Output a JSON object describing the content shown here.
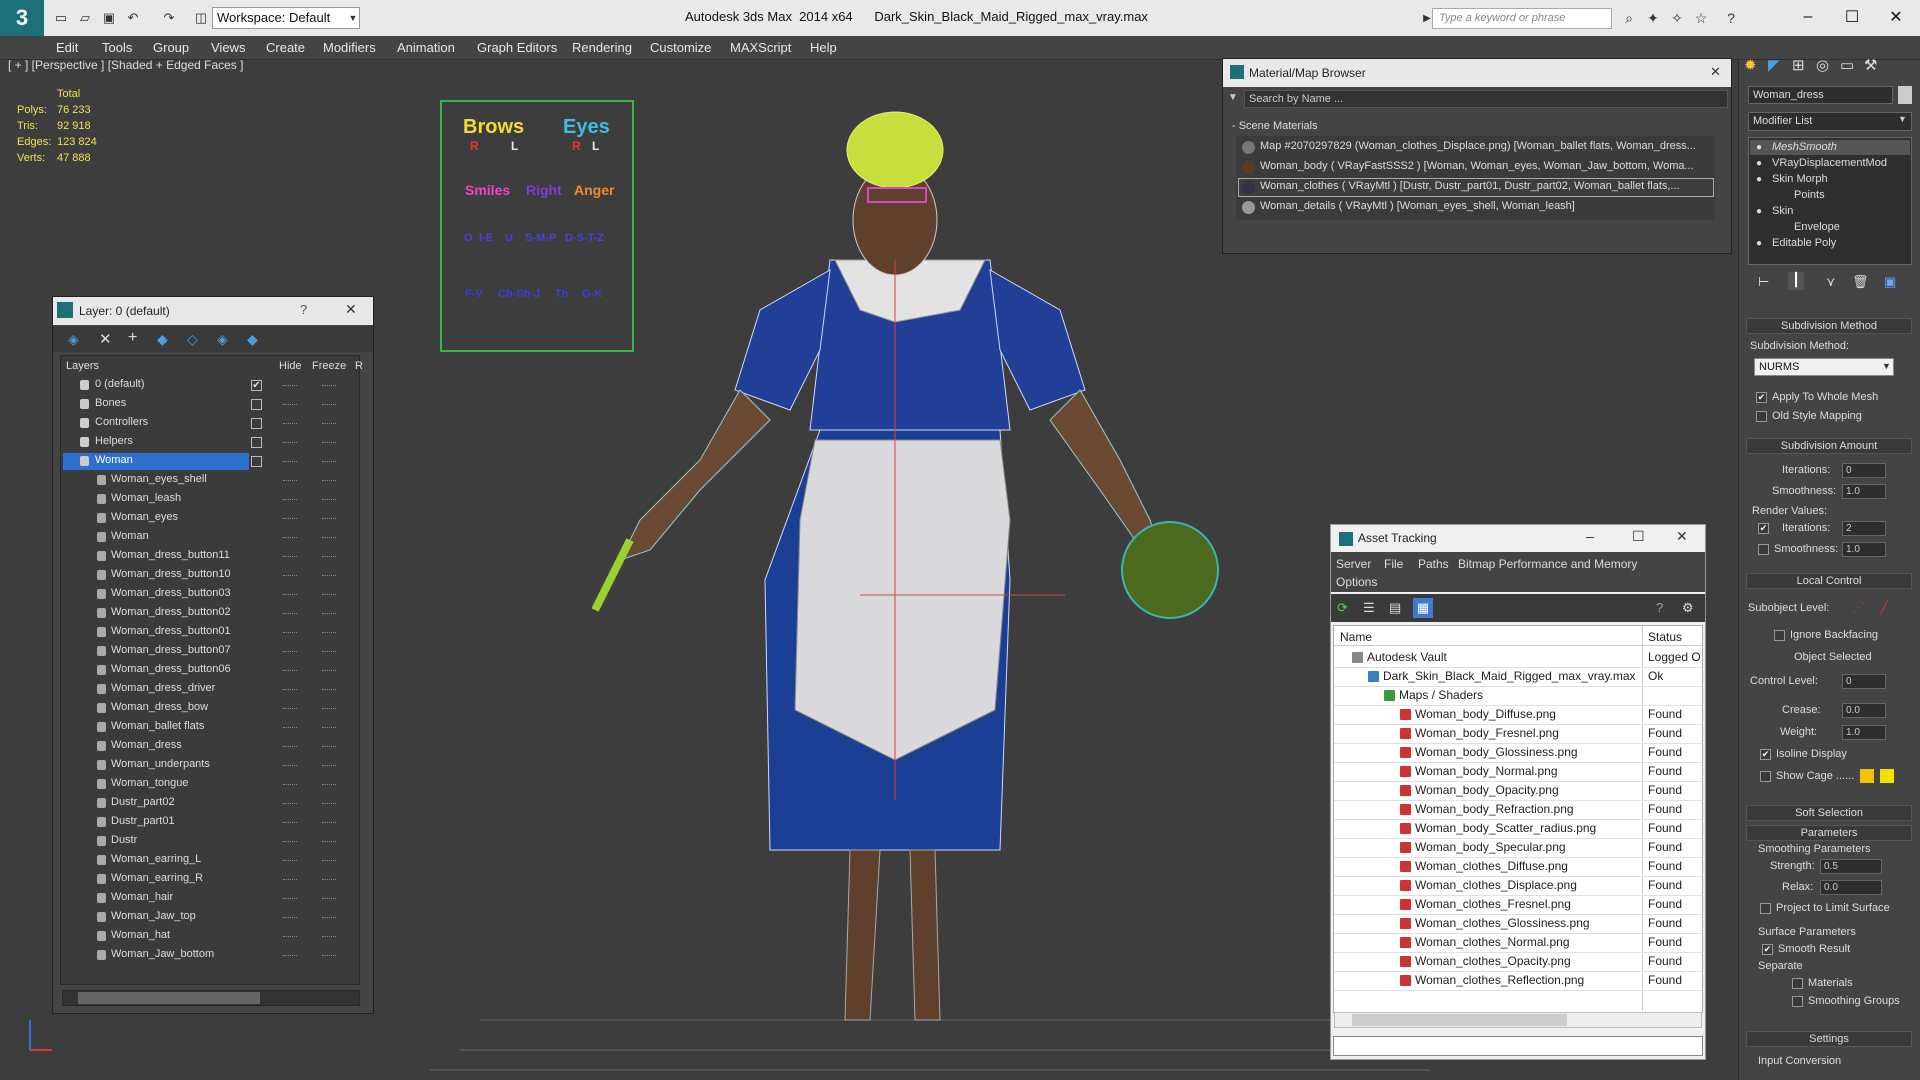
{
  "app": {
    "title": "Autodesk 3ds Max  2014 x64      Dark_Skin_Black_Maid_Rigged_max_vray.max",
    "workspace": "Workspace: Default",
    "search_placeholder": "Type a keyword or phrase"
  },
  "menus": [
    "Edit",
    "Tools",
    "Group",
    "Views",
    "Create",
    "Modifiers",
    "Animation",
    "Graph Editors",
    "Rendering",
    "Customize",
    "MAXScript",
    "Help"
  ],
  "viewport": {
    "label": "[ + ] [Perspective ] [Shaded + Edged Faces ]",
    "stats": {
      "total": "Total",
      "polys_label": "Polys:",
      "polys": "76 233",
      "tris_label": "Tris:",
      "tris": "92 918",
      "edges_label": "Edges:",
      "edges": "123 824",
      "verts_label": "Verts:",
      "verts": "47 888"
    }
  },
  "facial_rig": {
    "brows": "Brows",
    "eyes": "Eyes",
    "r": "R",
    "l": "L",
    "smiles": "Smiles",
    "right": "Right",
    "anger": "Anger",
    "row3": [
      "O",
      "I-E",
      "U",
      "S-M-P",
      "D-S-T-Z"
    ],
    "row4": [
      "F-V",
      "Ch-Sh-J",
      "Th",
      "G-K"
    ]
  },
  "layer_panel": {
    "title": "Layer: 0 (default)",
    "help": "?",
    "col_layers": "Layers",
    "col_hide": "Hide",
    "col_freeze": "Freeze",
    "col_r": "R",
    "layers": [
      {
        "name": "0 (default)",
        "top": true,
        "check": "✔"
      },
      {
        "name": "Bones",
        "top": true,
        "check": ""
      },
      {
        "name": "Controllers",
        "top": true,
        "check": ""
      },
      {
        "name": "Helpers",
        "top": true,
        "check": ""
      },
      {
        "name": "Woman",
        "top": true,
        "check": "",
        "selected": true
      },
      {
        "name": "Woman_eyes_shell"
      },
      {
        "name": "Woman_leash"
      },
      {
        "name": "Woman_eyes"
      },
      {
        "name": "Woman"
      },
      {
        "name": "Woman_dress_button11"
      },
      {
        "name": "Woman_dress_button10"
      },
      {
        "name": "Woman_dress_button03"
      },
      {
        "name": "Woman_dress_button02"
      },
      {
        "name": "Woman_dress_button01"
      },
      {
        "name": "Woman_dress_button07"
      },
      {
        "name": "Woman_dress_button06"
      },
      {
        "name": "Woman_dress_driver"
      },
      {
        "name": "Woman_dress_bow"
      },
      {
        "name": "Woman_ballet flats"
      },
      {
        "name": "Woman_dress"
      },
      {
        "name": "Woman_underpants"
      },
      {
        "name": "Woman_tongue"
      },
      {
        "name": "Dustr_part02"
      },
      {
        "name": "Dustr_part01"
      },
      {
        "name": "Dustr"
      },
      {
        "name": "Woman_earring_L"
      },
      {
        "name": "Woman_earring_R"
      },
      {
        "name": "Woman_hair"
      },
      {
        "name": "Woman_Jaw_top"
      },
      {
        "name": "Woman_hat"
      },
      {
        "name": "Woman_Jaw_bottom"
      }
    ]
  },
  "material_browser": {
    "title": "Material/Map Browser",
    "search": "Search by Name ...",
    "section": "- Scene Materials",
    "items": [
      "Map #2070297829 (Woman_clothes_Displace.png) [Woman_ballet flats, Woman_dress...",
      "Woman_body  ( VRayFastSSS2 )  [Woman, Woman_eyes, Woman_Jaw_bottom, Woma...",
      "Woman_clothes  ( VRayMtl )  [Dustr, Dustr_part01, Dustr_part02, Woman_ballet flats,...",
      "Woman_details  ( VRayMtl )  [Woman_eyes_shell, Woman_leash]"
    ]
  },
  "asset_tracking": {
    "title": "Asset Tracking",
    "menus": [
      "Server",
      "File",
      "Paths",
      "Bitmap Performance and Memory"
    ],
    "options": "Options",
    "col_name": "Name",
    "col_status": "Status",
    "rows": [
      {
        "name": "Autodesk Vault",
        "status": "Logged O",
        "indent": 0
      },
      {
        "name": "Dark_Skin_Black_Maid_Rigged_max_vray.max",
        "status": "Ok",
        "indent": 1
      },
      {
        "name": "Maps / Shaders",
        "status": "",
        "indent": 2
      },
      {
        "name": "Woman_body_Diffuse.png",
        "status": "Found",
        "indent": 3
      },
      {
        "name": "Woman_body_Fresnel.png",
        "status": "Found",
        "indent": 3
      },
      {
        "name": "Woman_body_Glossiness.png",
        "status": "Found",
        "indent": 3
      },
      {
        "name": "Woman_body_Normal.png",
        "status": "Found",
        "indent": 3
      },
      {
        "name": "Woman_body_Opacity.png",
        "status": "Found",
        "indent": 3
      },
      {
        "name": "Woman_body_Refraction.png",
        "status": "Found",
        "indent": 3
      },
      {
        "name": "Woman_body_Scatter_radius.png",
        "status": "Found",
        "indent": 3
      },
      {
        "name": "Woman_body_Specular.png",
        "status": "Found",
        "indent": 3
      },
      {
        "name": "Woman_clothes_Diffuse.png",
        "status": "Found",
        "indent": 3
      },
      {
        "name": "Woman_clothes_Displace.png",
        "status": "Found",
        "indent": 3
      },
      {
        "name": "Woman_clothes_Fresnel.png",
        "status": "Found",
        "indent": 3
      },
      {
        "name": "Woman_clothes_Glossiness.png",
        "status": "Found",
        "indent": 3
      },
      {
        "name": "Woman_clothes_Normal.png",
        "status": "Found",
        "indent": 3
      },
      {
        "name": "Woman_clothes_Opacity.png",
        "status": "Found",
        "indent": 3
      },
      {
        "name": "Woman_clothes_Reflection.png",
        "status": "Found",
        "indent": 3
      }
    ]
  },
  "command_panel": {
    "object_name": "Woman_dress",
    "modifier_list": "Modifier List",
    "stack": [
      {
        "name": "MeshSmooth",
        "italic": true
      },
      {
        "name": "VRayDisplacementMod"
      },
      {
        "name": "Skin Morph"
      },
      {
        "name": "Points",
        "sub": true
      },
      {
        "name": "Skin"
      },
      {
        "name": "Envelope",
        "sub": true
      },
      {
        "name": "Editable Poly"
      }
    ],
    "subdivision_method_head": "Subdivision Method",
    "subdivision_method_label": "Subdivision Method:",
    "subdivision_method": "NURMS",
    "apply_whole_mesh": "Apply To Whole Mesh",
    "old_style": "Old Style Mapping",
    "subdivision_amount_head": "Subdivision Amount",
    "iterations_label": "Iterations:",
    "iterations": "0",
    "smoothness_label": "Smoothness:",
    "smoothness": "1.0",
    "render_values": "Render Values:",
    "r_iterations": "2",
    "r_smoothness": "1.0",
    "local_control_head": "Local Control",
    "subobject_level": "Subobject Level:",
    "ignore_backfacing": "Ignore Backfacing",
    "object_selected": "Object Selected",
    "control_level_label": "Control Level:",
    "control_level": "0",
    "crease_label": "Crease:",
    "crease": "0.0",
    "weight_label": "Weight:",
    "weight": "1.0",
    "isoline": "Isoline Display",
    "show_cage": "Show Cage ......",
    "soft_selection_head": "Soft Selection",
    "parameters_head": "Parameters",
    "smoothing_params": "Smoothing Parameters",
    "strength_label": "Strength:",
    "strength": "0.5",
    "relax_label": "Relax:",
    "relax": "0.0",
    "project_limit": "Project to Limit Surface",
    "surface_params": "Surface Parameters",
    "smooth_result": "Smooth Result",
    "separate": "Separate",
    "materials": "Materials",
    "smoothing_groups": "Smoothing Groups",
    "settings_head": "Settings",
    "input_conversion": "Input Conversion"
  }
}
